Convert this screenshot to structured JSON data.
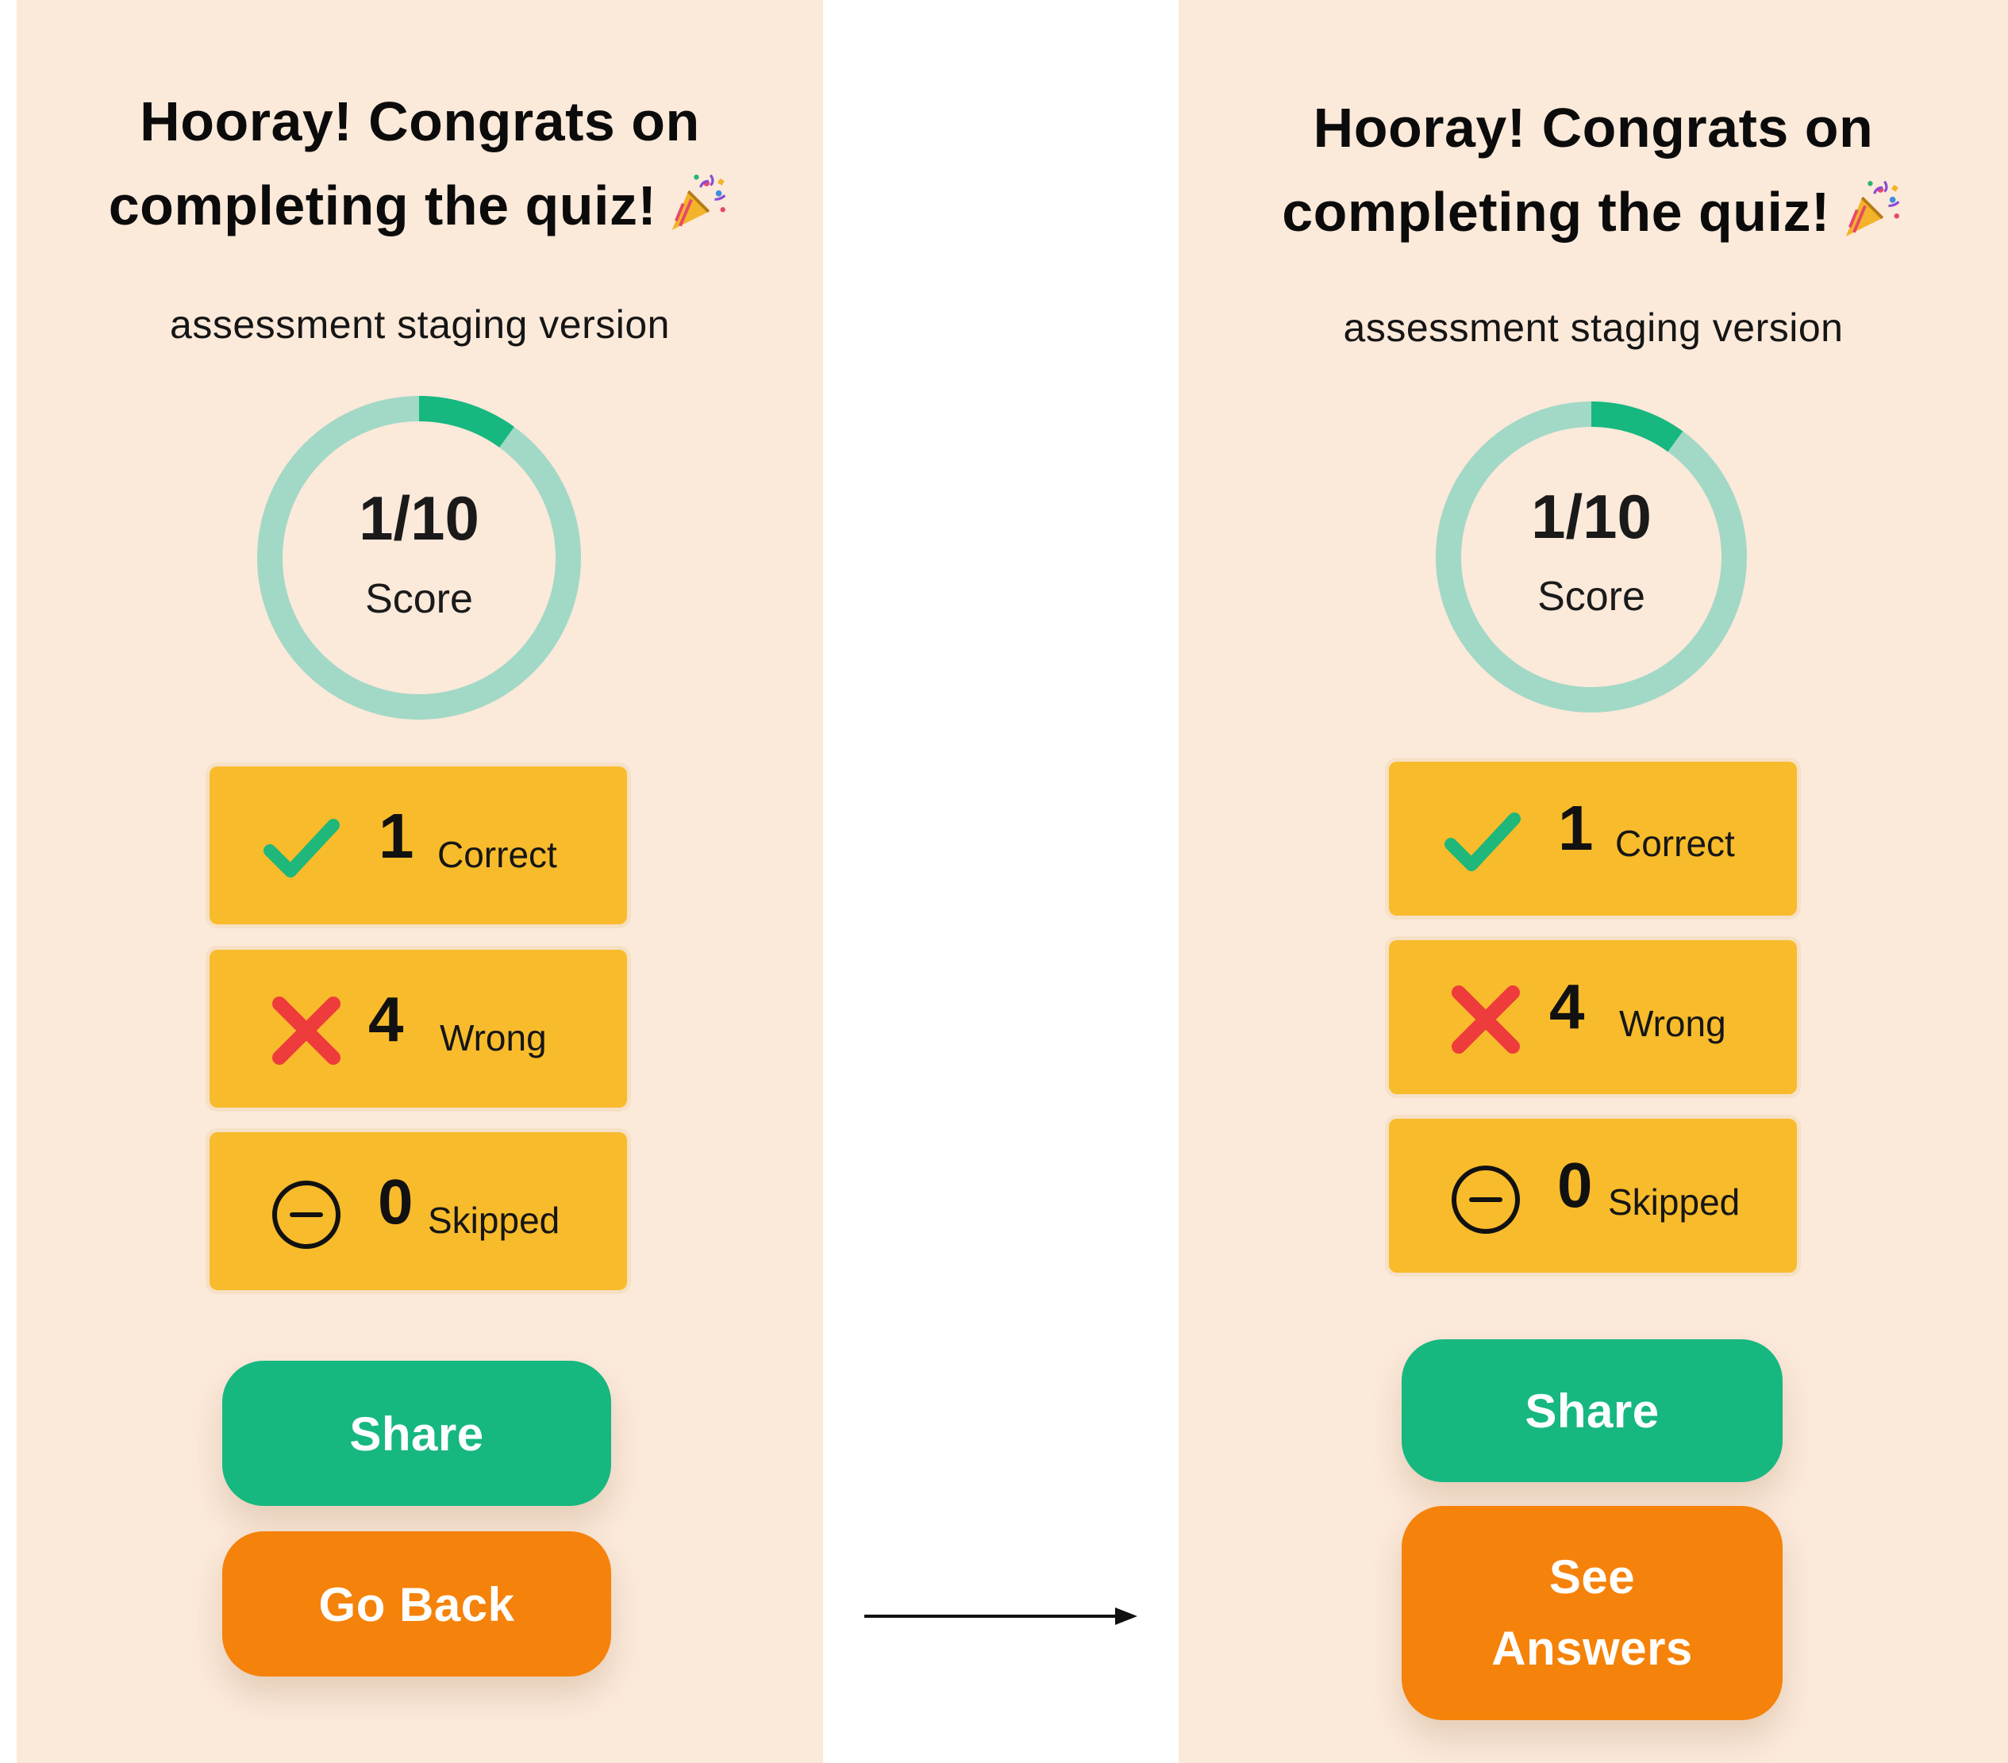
{
  "screens": [
    {
      "title_line1": "Hooray! Congrats on",
      "title_line2": "completing the quiz!",
      "subtitle": "assessment staging version",
      "score": {
        "value": "1/10",
        "label": "Score",
        "fraction": 0.1
      },
      "stats": [
        {
          "icon": "check-icon",
          "count": "1",
          "label": "Correct"
        },
        {
          "icon": "x-icon",
          "count": "4",
          "label": "Wrong"
        },
        {
          "icon": "minus-circle-icon",
          "count": "0",
          "label": "Skipped"
        }
      ],
      "share_button": "Share",
      "secondary_button": "Go Back"
    },
    {
      "title_line1": "Hooray! Congrats on",
      "title_line2": "completing the quiz!",
      "subtitle": "assessment staging version",
      "score": {
        "value": "1/10",
        "label": "Score",
        "fraction": 0.1
      },
      "stats": [
        {
          "icon": "check-icon",
          "count": "1",
          "label": "Correct"
        },
        {
          "icon": "x-icon",
          "count": "4",
          "label": "Wrong"
        },
        {
          "icon": "minus-circle-icon",
          "count": "0",
          "label": "Skipped"
        }
      ],
      "share_button": "Share",
      "secondary_button_line1": "See",
      "secondary_button_line2": "Answers"
    }
  ],
  "transition_icon": "right-arrow-icon",
  "colors": {
    "panel_bg": "#fbe9da",
    "card_bg": "#f8bb2b",
    "share_green": "#17b780",
    "secondary_orange": "#f5820a",
    "ring_track": "#a2d8c6",
    "ring_progress": "#17b780",
    "check_green": "#1fb77a",
    "wrong_red": "#ee3b3b"
  }
}
